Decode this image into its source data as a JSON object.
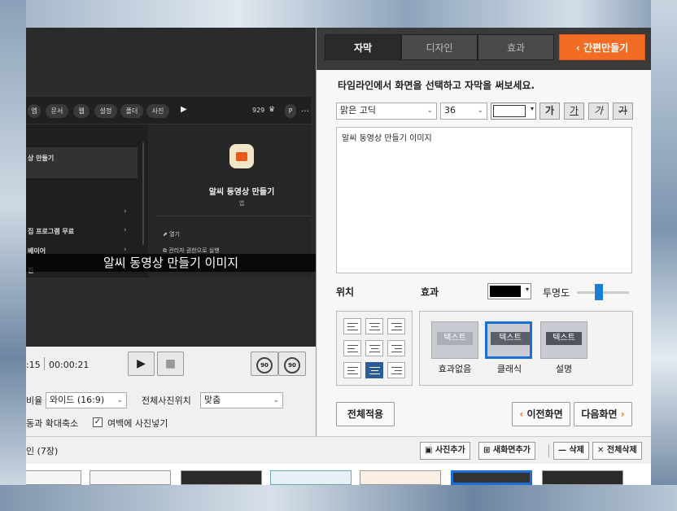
{
  "preview": {
    "shot_menu": [
      "엡",
      "문서",
      "웹",
      "설정",
      "폴더",
      "사진"
    ],
    "shot_badge": "929",
    "shot_p": "P",
    "shot_sidebar": [
      "상 만들기",
      "집 프로그램 무료",
      "베이어",
      "진"
    ],
    "card_title": "알씨 동영상 만들기",
    "card_sub": "앱",
    "card_items": [
      "열기",
      "관리자 권한으로 실행"
    ],
    "subtitle": "알씨 동영상 만들기 이미지"
  },
  "controls": {
    "time_current": ":15",
    "time_total": "00:00:21",
    "back_label": "90",
    "fwd_label": "90"
  },
  "options": {
    "ratio_label": "비율",
    "ratio_value": "와이드 (16:9)",
    "position_label": "전체사진위치",
    "position_value": "맞춤",
    "motion_label": "동과 확대축소",
    "margin_label": "여백에 사진넣기"
  },
  "tabs": {
    "subtitle": "자막",
    "design": "디자인",
    "effect": "효과",
    "quick": "간편만들기"
  },
  "panel": {
    "instruction": "타임라인에서 화면을 선택하고 자막을 써보세요.",
    "font": "맑은 고딕",
    "size": "36",
    "fmt": [
      "가",
      "가",
      "가",
      "가"
    ],
    "text": "알씨 동영상 만들기 이미지",
    "position_label": "위치",
    "effect_label": "효과",
    "opacity_label": "투명도",
    "opacity": 0.4,
    "effects": [
      {
        "tag": "텍스트",
        "name": "효과없음"
      },
      {
        "tag": "텍스트",
        "name": "클래식"
      },
      {
        "tag": "텍스트",
        "name": "설명"
      }
    ],
    "apply_all": "전체적용",
    "prev": "이전화면",
    "next": "다음화면"
  },
  "strip": {
    "label": "인 (7장)",
    "add_photo": "사진추가",
    "new_screen": "새화면추가",
    "delete": "삭제",
    "delete_all": "전체삭제"
  },
  "colors": {
    "accent": "#f26c24",
    "selected": "#1a6fd4"
  }
}
